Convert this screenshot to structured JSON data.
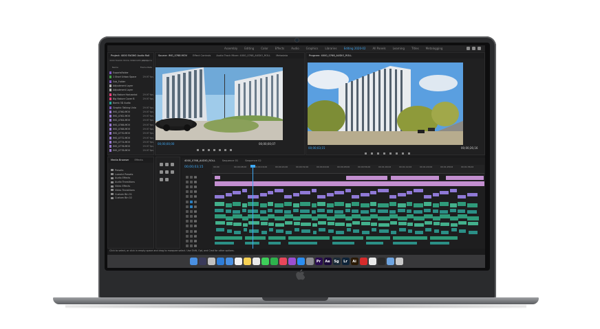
{
  "workspaces": [
    {
      "label": "Assembly",
      "active": false
    },
    {
      "label": "Editing",
      "active": false
    },
    {
      "label": "Color",
      "active": false
    },
    {
      "label": "Effects",
      "active": false
    },
    {
      "label": "Audio",
      "active": false
    },
    {
      "label": "Graphics",
      "active": false
    },
    {
      "label": "Libraries",
      "active": false
    },
    {
      "label": "Editing 2020-02",
      "active": true
    },
    {
      "label": "All Panels",
      "active": false
    },
    {
      "label": "Learning",
      "active": false
    },
    {
      "label": "Titles",
      "active": false
    },
    {
      "label": "Metalogging",
      "active": false
    }
  ],
  "source_panel": {
    "tabs": [
      "Source: IMG_0768.MOV",
      "Effect Controls",
      "Audio Track Mixer: 4000_0768_AUDIO_ROLL",
      "Metadata"
    ],
    "timecode_in": "00;00;00;00",
    "timecode_out": "00;00;00;07"
  },
  "program_panel": {
    "tabs": [
      "Program: 4000_0768_AUDIO_ROLL"
    ],
    "timecode_in": "00;00;03;15",
    "timecode_out": "00;00;26;16"
  },
  "project_panel": {
    "title": "Project: 4000 FAGNO Audio Roll",
    "path": "4000 FAGNO HDDG WINDOWS prproj",
    "count": "460 Items",
    "column_name": "Name",
    "column_rate": "Frame Rate",
    "items": [
      {
        "name": "ExportsFolder",
        "rate": "",
        "color": "#7e57c2"
      },
      {
        "name": "1 Short Urban Space",
        "rate": "29.97 fps",
        "color": "#43a047"
      },
      {
        "name": "Sub_Folder",
        "rate": "",
        "color": "#7e57c2"
      },
      {
        "name": "Adjustment Layer",
        "rate": "",
        "color": "#b0b0b0"
      },
      {
        "name": "Adjustment Layer",
        "rate": "",
        "color": "#b0b0b0"
      },
      {
        "name": "Big Nature Horizontal",
        "rate": "29.97 fps",
        "color": "#ec407a"
      },
      {
        "name": "Big Nature Cover B",
        "rate": "29.97 fps",
        "color": "#ec407a"
      },
      {
        "name": "Bomb 3D Audio",
        "rate": "",
        "color": "#26a69a"
      },
      {
        "name": "Graphic Talking Unlo",
        "rate": "29.97 fps",
        "color": "#7e57c2"
      },
      {
        "name": "IMG_0760.MOV",
        "rate": "29.97 fps",
        "color": "#9575cd"
      },
      {
        "name": "IMG_0762.MOV",
        "rate": "29.97 fps",
        "color": "#9575cd"
      },
      {
        "name": "IMG_0764.MOV",
        "rate": "29.97 fps",
        "color": "#9575cd"
      },
      {
        "name": "IMG_0766.MOV",
        "rate": "29.97 fps",
        "color": "#9575cd"
      },
      {
        "name": "IMG_0768.MOV",
        "rate": "29.97 fps",
        "color": "#9575cd"
      },
      {
        "name": "IMG_0770.MOV",
        "rate": "29.97 fps",
        "color": "#9575cd"
      },
      {
        "name": "IMG_0772.MOV",
        "rate": "29.97 fps",
        "color": "#9575cd"
      },
      {
        "name": "IMG_0774.MOV",
        "rate": "29.97 fps",
        "color": "#9575cd"
      },
      {
        "name": "IMG_0776.MOV",
        "rate": "29.97 fps",
        "color": "#9575cd"
      },
      {
        "name": "IMG_0778.MOV",
        "rate": "29.97 fps",
        "color": "#9575cd"
      }
    ]
  },
  "effects_panel": {
    "tabs": [
      "Media Browser",
      "Effects"
    ],
    "items": [
      "Presets",
      "Lumetri Presets",
      "Audio Effects",
      "Audio Transitions",
      "Video Effects",
      "Video Transitions",
      "Custom Bin 01",
      "Custom Bin 02"
    ]
  },
  "timeline": {
    "tabs": [
      "4000_0768_AUDIO_ROLL",
      "Sequence 01",
      "Sequence 02"
    ],
    "timecode": "00;00;03;15",
    "ruler": [
      "00;00",
      "00;00;08;00",
      "00;00;16;00",
      "00;00;24;00",
      "00;00;32;00",
      "00;00;40;00",
      "00;00;48;00",
      "00;00;56;00",
      "00;01;04;02",
      "00;01;12;02",
      "00;01;20;02",
      "00;01;28;02",
      "00;01;36;02"
    ],
    "tracks": [
      "V6",
      "V5",
      "V4",
      "V3",
      "V2",
      "V1",
      "A1",
      "A2",
      "A3",
      "A4",
      "A5",
      "A6",
      "A7",
      "A8",
      "A9"
    ],
    "adjustment_clip": "Adjustment Layer"
  },
  "status_bar": "Click to select, or click in empty space and drag to marquee select. Use Shift, Opt, and Cmd for other options.",
  "dock_icons": [
    "finder-icon",
    "siri-icon",
    "launchpad-icon",
    "safari-icon",
    "mail-icon",
    "calendar-icon",
    "notes-icon",
    "photos-icon",
    "messages-icon",
    "facetime-icon",
    "music-icon",
    "podcasts-icon",
    "app-store-icon",
    "settings-icon",
    "premiere-pro-icon",
    "after-effects-icon",
    "speedgrade-icon",
    "lightroom-icon",
    "illustrator-icon",
    "creative-cloud-icon",
    "chrome-icon",
    "terminal-icon",
    "finder-folder-icon",
    "trash-icon"
  ],
  "dock_labels": [
    "",
    "",
    "",
    "",
    "",
    "",
    "",
    "",
    "",
    "",
    "",
    "",
    "",
    "",
    "Pr",
    "Ae",
    "Sg",
    "Lr",
    "Ai",
    "",
    "",
    "",
    "",
    ""
  ],
  "colors": {
    "accent": "#3fa9f5",
    "clip_pink": "#c38fd0",
    "clip_green": "#2f9a7a",
    "laptop": "#2a2b2d"
  }
}
